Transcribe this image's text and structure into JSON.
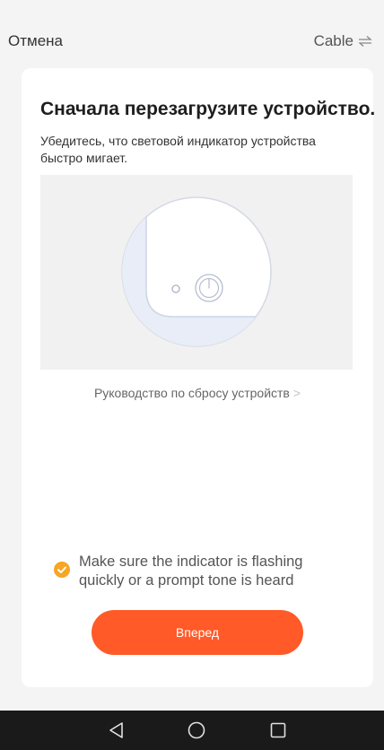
{
  "header": {
    "cancel_label": "Отмена",
    "mode_label": "Cable",
    "mode_icon": "swap-arrows-icon"
  },
  "card": {
    "title": "Сначала перезагрузите устройство.",
    "subtitle": "Убедитесь, что световой индикатор устройства быстро мигает.",
    "illustration_icon": "power-button-icon",
    "guide_link": "Руководство по сбросу устройств",
    "guide_chevron": ">",
    "confirm_text": "Make sure the indicator is flashing quickly or a prompt tone is heard",
    "confirm_checked": true,
    "next_button": "Вперед"
  },
  "navbar": {
    "back_icon": "back-triangle-icon",
    "home_icon": "home-circle-icon",
    "recents_icon": "recents-square-icon"
  },
  "colors": {
    "accent": "#ff5a28",
    "check": "#f5a623",
    "background": "#f4f4f4"
  }
}
